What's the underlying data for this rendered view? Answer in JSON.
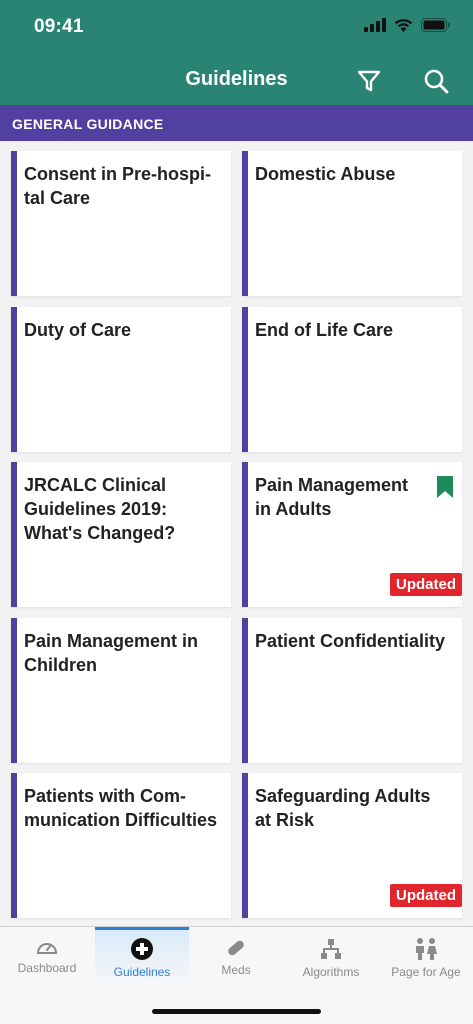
{
  "status_bar": {
    "time": "09:41"
  },
  "header": {
    "title": "Guidelines"
  },
  "section": {
    "title": "GENERAL GUIDANCE"
  },
  "accent_color": "#5240a0",
  "header_color": "#2a8474",
  "cards": [
    {
      "title": "Consent in Pre-hospi-tal Care",
      "badge": "",
      "bookmarked": false
    },
    {
      "title": "Domestic Abuse",
      "badge": "",
      "bookmarked": false
    },
    {
      "title": "Duty of Care",
      "badge": "",
      "bookmarked": false
    },
    {
      "title": "End of Life Care",
      "badge": "",
      "bookmarked": false
    },
    {
      "title": "JRCALC Clinical Guidelines 2019: What's Changed?",
      "badge": "",
      "bookmarked": false
    },
    {
      "title": "Pain Management in Adults",
      "badge": "Updated",
      "bookmarked": true
    },
    {
      "title": "Pain Management in Children",
      "badge": "",
      "bookmarked": false
    },
    {
      "title": "Patient Confidentiality",
      "badge": "",
      "bookmarked": false
    },
    {
      "title": "Patients with Com-munication Difficulties",
      "badge": "",
      "bookmarked": false
    },
    {
      "title": "Safeguarding Adults at Risk",
      "badge": "Updated",
      "bookmarked": false
    }
  ],
  "tabs": [
    {
      "label": "Dashboard",
      "icon": "gauge-icon",
      "active": false
    },
    {
      "label": "Guidelines",
      "icon": "medical-cross-icon",
      "active": true
    },
    {
      "label": "Meds",
      "icon": "pill-icon",
      "active": false
    },
    {
      "label": "Algorithms",
      "icon": "flowchart-icon",
      "active": false
    },
    {
      "label": "Page for Age",
      "icon": "people-icon",
      "active": false
    }
  ]
}
